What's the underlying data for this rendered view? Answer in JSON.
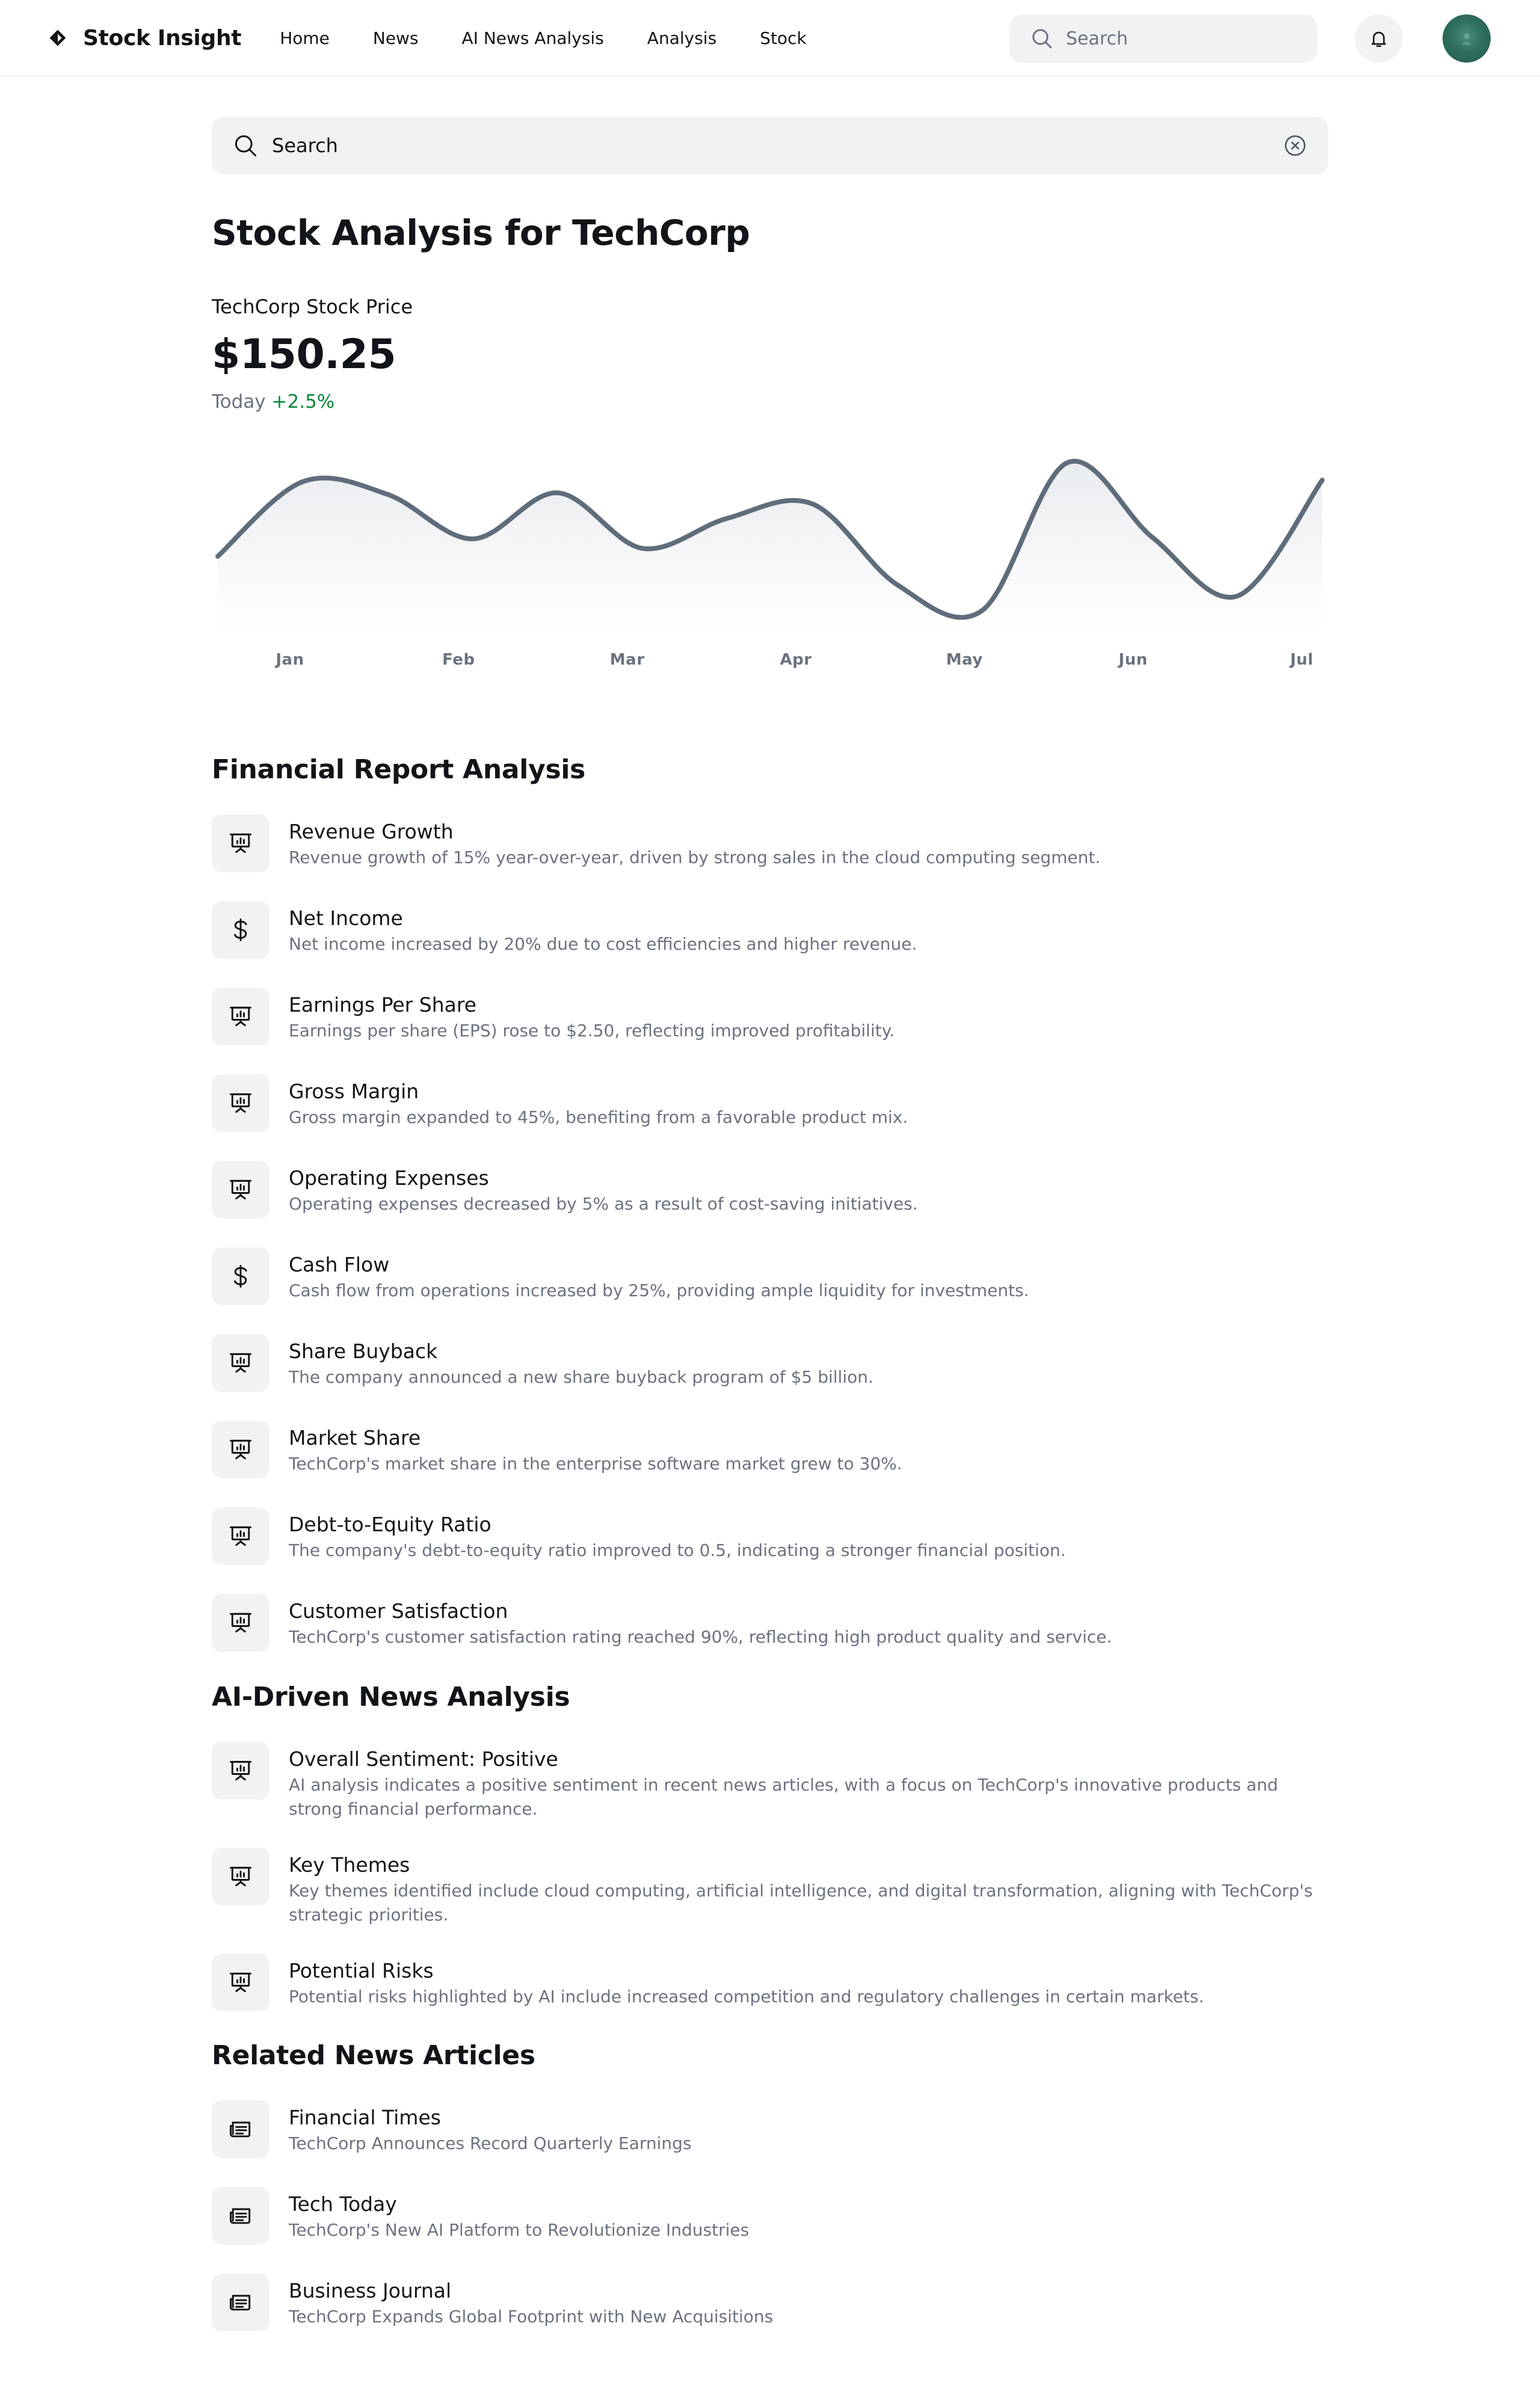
{
  "header": {
    "brand": "Stock Insight",
    "nav": [
      "Home",
      "News",
      "AI News Analysis",
      "Analysis",
      "Stock"
    ],
    "search_placeholder": "Search",
    "icons": {
      "logo": "diamond-logo-icon",
      "search": "search-icon",
      "notifications": "bell-icon",
      "avatar": "user-avatar"
    }
  },
  "main": {
    "search_placeholder": "Search",
    "page_title": "Stock Analysis for TechCorp",
    "price": {
      "label": "TechCorp Stock Price",
      "value": "$150.25",
      "period": "Today",
      "change": "+2.5%",
      "change_color": "#078838"
    }
  },
  "chart_data": {
    "type": "area",
    "categories": [
      "Jan",
      "Feb",
      "Mar",
      "Apr",
      "May",
      "Jun",
      "Jul"
    ],
    "series": [
      {
        "values": [
          0.36,
          0.83,
          0.75,
          0.47,
          0.76,
          0.41,
          0.6,
          0.69,
          0.18,
          0.02,
          0.95,
          0.48,
          0.11,
          0.84
        ]
      }
    ],
    "stroke_color": "#5f6c7b",
    "grid": false
  },
  "financial_report": {
    "title": "Financial Report Analysis",
    "items": [
      {
        "icon": "presentation-chart-icon",
        "title": "Revenue Growth",
        "desc": "Revenue growth of 15% year-over-year, driven by strong sales in the cloud computing segment."
      },
      {
        "icon": "dollar-icon",
        "title": "Net Income",
        "desc": "Net income increased by 20% due to cost efficiencies and higher revenue."
      },
      {
        "icon": "presentation-chart-icon",
        "title": "Earnings Per Share",
        "desc": "Earnings per share (EPS) rose to $2.50, reflecting improved profitability."
      },
      {
        "icon": "presentation-chart-icon",
        "title": "Gross Margin",
        "desc": "Gross margin expanded to 45%, benefiting from a favorable product mix."
      },
      {
        "icon": "presentation-chart-icon",
        "title": "Operating Expenses",
        "desc": "Operating expenses decreased by 5% as a result of cost-saving initiatives."
      },
      {
        "icon": "dollar-icon",
        "title": "Cash Flow",
        "desc": "Cash flow from operations increased by 25%, providing ample liquidity for investments."
      },
      {
        "icon": "presentation-chart-icon",
        "title": "Share Buyback",
        "desc": "The company announced a new share buyback program of $5 billion."
      },
      {
        "icon": "presentation-chart-icon",
        "title": "Market Share",
        "desc": "TechCorp's market share in the enterprise software market grew to 30%."
      },
      {
        "icon": "presentation-chart-icon",
        "title": "Debt-to-Equity Ratio",
        "desc": "The company's debt-to-equity ratio improved to 0.5, indicating a stronger financial position."
      },
      {
        "icon": "presentation-chart-icon",
        "title": "Customer Satisfaction",
        "desc": "TechCorp's customer satisfaction rating reached 90%, reflecting high product quality and service."
      }
    ]
  },
  "ai_analysis": {
    "title": "AI-Driven News Analysis",
    "items": [
      {
        "icon": "presentation-chart-icon",
        "title": "Overall Sentiment: Positive",
        "desc": "AI analysis indicates a positive sentiment in recent news articles, with a focus on TechCorp's innovative products and strong financial performance."
      },
      {
        "icon": "presentation-chart-icon",
        "title": "Key Themes",
        "desc": "Key themes identified include cloud computing, artificial intelligence, and digital transformation, aligning with TechCorp's strategic priorities."
      },
      {
        "icon": "presentation-chart-icon",
        "title": "Potential Risks",
        "desc": "Potential risks highlighted by AI include increased competition and regulatory challenges in certain markets."
      }
    ]
  },
  "related_news": {
    "title": "Related News Articles",
    "items": [
      {
        "icon": "newspaper-icon",
        "title": "Financial Times",
        "desc": "TechCorp Announces Record Quarterly Earnings"
      },
      {
        "icon": "newspaper-icon",
        "title": "Tech Today",
        "desc": "TechCorp's New AI Platform to Revolutionize Industries"
      },
      {
        "icon": "newspaper-icon",
        "title": "Business Journal",
        "desc": "TechCorp Expands Global Footprint with New Acquisitions"
      }
    ]
  }
}
